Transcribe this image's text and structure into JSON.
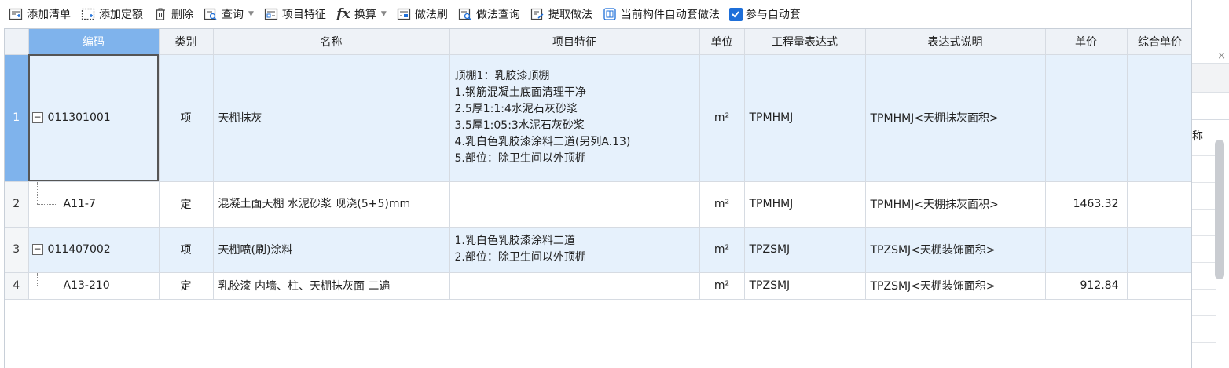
{
  "toolbar": {
    "add_list": "添加清单",
    "add_quota": "添加定额",
    "delete": "删除",
    "query": "查询",
    "item_feature": "项目特征",
    "convert": "换算",
    "method_brush": "做法刷",
    "method_query": "做法查询",
    "extract_method": "提取做法",
    "auto_apply_current": "当前构件自动套做法",
    "participate_auto": "参与自动套",
    "participate_auto_checked": true,
    "fx_symbol": "fx"
  },
  "columns": [
    "编码",
    "类别",
    "名称",
    "项目特征",
    "单位",
    "工程量表达式",
    "表达式说明",
    "单价",
    "综合单价"
  ],
  "rows": [
    {
      "num": "1",
      "code": "011301001",
      "type": "项",
      "name": "天棚抹灰",
      "feature": [
        "顶棚1：乳胶漆顶棚",
        "1.钢筋混凝土底面清理干净",
        "2.5厚1:1:4水泥石灰砂浆",
        "3.5厚1:05:3水泥石灰砂浆",
        "4.乳白色乳胶漆涂料二道(另列A.13)",
        "5.部位：除卫生间以外顶棚"
      ],
      "unit": "m²",
      "expr": "TPMHMJ",
      "expr_desc": "TPMHMJ<天棚抹灰面积>",
      "price": "",
      "total_price": ""
    },
    {
      "num": "2",
      "code": "A11-7",
      "type": "定",
      "name": "混凝土面天棚 水泥砂浆 现浇(5+5)mm",
      "feature": [],
      "unit": "m²",
      "expr": "TPMHMJ",
      "expr_desc": "TPMHMJ<天棚抹灰面积>",
      "price": "1463.32",
      "total_price": ""
    },
    {
      "num": "3",
      "code": "011407002",
      "type": "项",
      "name": "天棚喷(刷)涂料",
      "feature": [
        "1.乳白色乳胶漆涂料二道",
        "2.部位：除卫生间以外顶棚"
      ],
      "unit": "m²",
      "expr": "TPZSMJ",
      "expr_desc": "TPZSMJ<天棚装饰面积>",
      "price": "",
      "total_price": ""
    },
    {
      "num": "4",
      "code": "A13-210",
      "type": "定",
      "name": "乳胶漆 内墙、柱、天棚抹灰面 二遍",
      "feature": [],
      "unit": "m²",
      "expr": "TPZSMJ",
      "expr_desc": "TPZSMJ<天棚装饰面积>",
      "price": "912.84",
      "total_price": ""
    }
  ],
  "side_panel": {
    "header_text": "称",
    "close_glyph": "×"
  },
  "colors": {
    "selected_header": "#7fb3ec",
    "selected_row_bg": "#e6f1fc",
    "checkbox": "#1e6fd9"
  }
}
